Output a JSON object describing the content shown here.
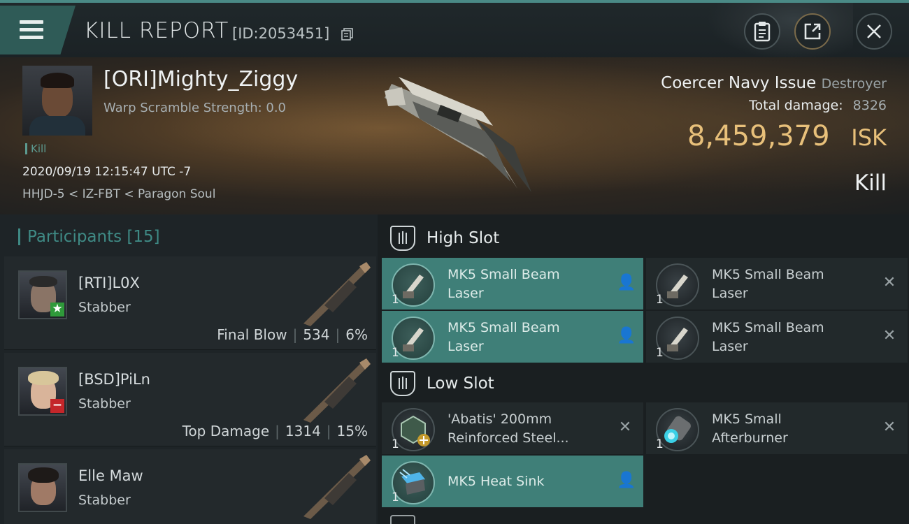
{
  "header": {
    "title": "KILL REPORT",
    "report_id": "[ID:2053451]",
    "buttons": [
      "clipboard-icon",
      "share-icon",
      "close-icon"
    ]
  },
  "victim": {
    "pilot_name": "[ORI]Mighty_Ziggy",
    "warp_scramble": "Warp Scramble Strength: 0.0",
    "kill_tag": "Kill",
    "datetime": "2020/09/19 12:15:47 UTC -7",
    "location": "HHJD-5 < IZ-FBT < Paragon Soul",
    "ship_name": "Coercer Navy Issue",
    "ship_class": "Destroyer",
    "total_damage_label": "Total damage:",
    "total_damage_value": "8326",
    "isk_value": "8,459,379",
    "isk_unit": "ISK",
    "result": "Kill"
  },
  "participants": {
    "title": "Participants",
    "count": "[15]",
    "rows": [
      {
        "name": "[RTI]L0X",
        "ship": "Stabber",
        "label": "Final Blow",
        "damage": "534",
        "percent": "6%",
        "badge": "star-icon",
        "badge_color": "#2f9a3a"
      },
      {
        "name": "[BSD]PiLn",
        "ship": "Stabber",
        "label": "Top Damage",
        "damage": "1314",
        "percent": "15%",
        "badge": "minus-icon",
        "badge_color": "#c4262a"
      },
      {
        "name": "Elle Maw",
        "ship": "Stabber",
        "label": "",
        "damage": "",
        "percent": "",
        "badge": "",
        "badge_color": ""
      }
    ]
  },
  "slots": {
    "high_slot_label": "High Slot",
    "low_slot_label": "Low Slot",
    "high": [
      {
        "qty": "1",
        "line1": "MK5 Small Beam",
        "line2": "Laser",
        "state": "fitted",
        "action": "person-icon"
      },
      {
        "qty": "1",
        "line1": "MK5 Small Beam",
        "line2": "Laser",
        "state": "destroyed",
        "action": "x-icon"
      },
      {
        "qty": "1",
        "line1": "MK5 Small Beam",
        "line2": "Laser",
        "state": "fitted",
        "action": "person-icon"
      },
      {
        "qty": "1",
        "line1": "MK5 Small Beam",
        "line2": "Laser",
        "state": "destroyed",
        "action": "x-icon"
      }
    ],
    "low": [
      {
        "qty": "1",
        "line1": "'Abatis' 200mm",
        "line2": "Reinforced Steel...",
        "state": "destroyed",
        "action": "x-icon"
      },
      {
        "qty": "1",
        "line1": "MK5 Small",
        "line2": "Afterburner",
        "state": "destroyed",
        "action": "x-icon"
      },
      {
        "qty": "1",
        "line1": "MK5 Heat Sink",
        "line2": "",
        "state": "fitted",
        "action": "person-icon"
      }
    ]
  },
  "colors": {
    "accent": "#3f7f78",
    "isk": "#e8c07a",
    "header_border": "#4a8a86"
  }
}
